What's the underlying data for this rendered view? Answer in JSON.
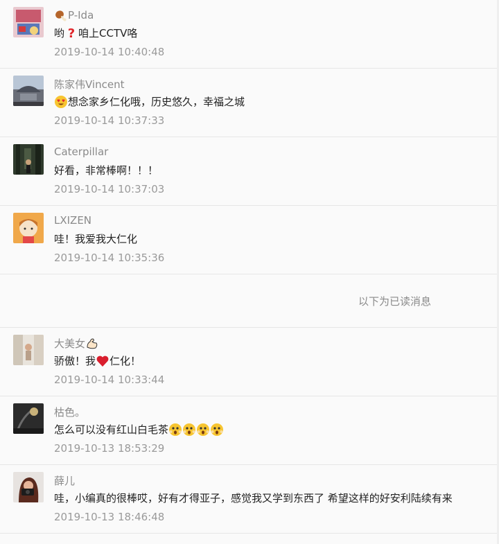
{
  "comments": [
    {
      "name": "P-Ida",
      "text_before": "哟",
      "text_after": "咱上CCTV咯",
      "time": "2019-10-14 10:40:48"
    },
    {
      "name": "陈家伟Vincent",
      "text_after": "想念家乡仁化哦，历史悠久，幸福之城",
      "time": "2019-10-14 10:37:33"
    },
    {
      "name": "Caterpillar",
      "text": "好看，非常棒啊！！！",
      "time": "2019-10-14 10:37:03"
    },
    {
      "name": "LXIZEN",
      "text": "哇！我爱我大仁化",
      "time": "2019-10-14 10:35:36"
    },
    {
      "name": "大美女",
      "text_before": "骄傲！我",
      "text_after": "仁化！",
      "time": "2019-10-14 10:33:44"
    },
    {
      "name": "枯色。",
      "text": "怎么可以没有红山白毛茶",
      "time": "2019-10-13 18:53:29"
    },
    {
      "name": "薛儿",
      "text": "哇，小编真的很棒哎，好有才得亚子，感觉我又学到东西了 希望这样的好安利陆续有来",
      "time": "2019-10-13 18:46:48"
    }
  ],
  "divider": {
    "label": "以下为已读消息"
  },
  "icons": {
    "name_prefix_1": "drumstick-icon",
    "content_prefix_2": "heart-eyes-emoji-icon",
    "question_mark": "red-question-mark-icon",
    "heart": "red-heart-icon",
    "muscle": "flexed-biceps-icon",
    "shock": "shocked-face-emoji-icon"
  },
  "colors": {
    "background": "#fafafa",
    "name_color": "#8a8a8a",
    "text_color": "#222222",
    "time_color": "#9a9a9a",
    "border_color": "#e6e6e6"
  }
}
